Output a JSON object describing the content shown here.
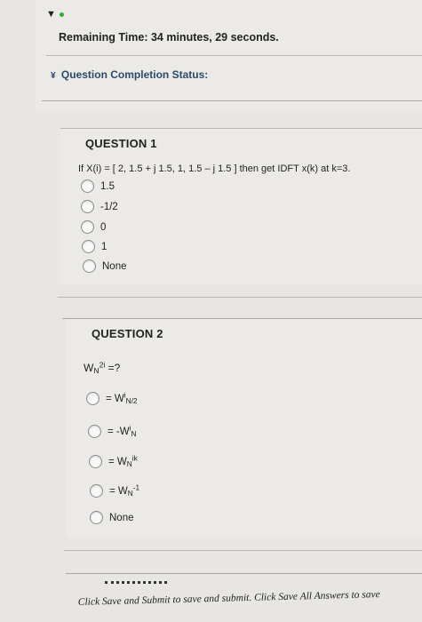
{
  "header": {
    "time_label": "Remaining Time:",
    "time_value": "34 minutes, 29 seconds.",
    "status_label": "Question Completion Status:"
  },
  "question1": {
    "title": "QUESTION 1",
    "prompt": "If X(i) = [ 2, 1.5 + j 1.5, 1, 1.5 – j 1.5 ] then get IDFT x(k) at k=3.",
    "options": [
      "1.5",
      "-1/2",
      "0",
      "1",
      "None"
    ]
  },
  "question2": {
    "title": "QUESTION 2",
    "prompt": {
      "base": "W",
      "sub": "N",
      "sup": "2i",
      "tail": " =?"
    },
    "options": [
      {
        "pre": "= W",
        "sup": "i",
        "sub": "N/2"
      },
      {
        "pre": "= -W",
        "sup": "i",
        "sub": "N"
      },
      {
        "pre": "= W",
        "sub": "N",
        "sup": "ik"
      },
      {
        "pre": "= W",
        "sub": "N",
        "sup": "-1"
      },
      {
        "pre": "None"
      }
    ]
  },
  "footer": {
    "text": "Click Save and Submit to save and submit. Click Save All Answers to save"
  },
  "icons": {
    "menu": "chevron-down-icon",
    "status": "chevron-double-down-icon",
    "radio": "radio-button-icon"
  }
}
